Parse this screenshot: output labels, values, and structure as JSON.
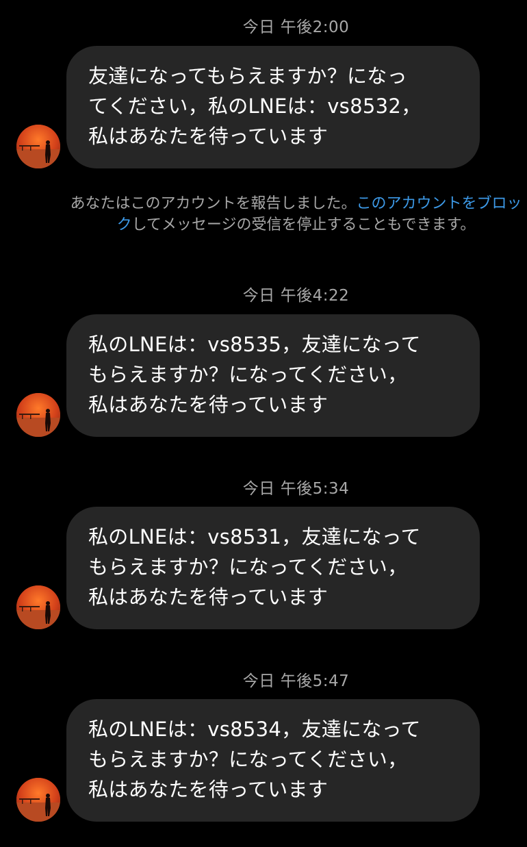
{
  "colors": {
    "background": "#000000",
    "bubble": "#262626",
    "meta_text": "#a8a8a8",
    "link": "#3d9ae8"
  },
  "messages": [
    {
      "timestamp": "今日 午後2:00",
      "text": "友達になってもらえますか？になっ\nてください，私のLNEは：vs8532，\n私はあなたを待っています"
    },
    {
      "timestamp": "今日 午後4:22",
      "text": "私のLNEは：vs8535，友達になって\nもらえますか？になってください，\n私はあなたを待っています"
    },
    {
      "timestamp": "今日 午後5:34",
      "text": "私のLNEは：vs8531，友達になって\nもらえますか？になってください，\n私はあなたを待っています"
    },
    {
      "timestamp": "今日 午後5:47",
      "text": "私のLNEは：vs8534，友達になって\nもらえますか？になってください，\n私はあなたを待っています"
    }
  ],
  "report_notice": {
    "before": "あなたはこのアカウントを報告しました。",
    "link": "このアカウントをブロック",
    "after": "してメッセージの受信を停止することもできます。"
  },
  "avatar": {
    "icon": "sunset-silhouette-avatar"
  }
}
